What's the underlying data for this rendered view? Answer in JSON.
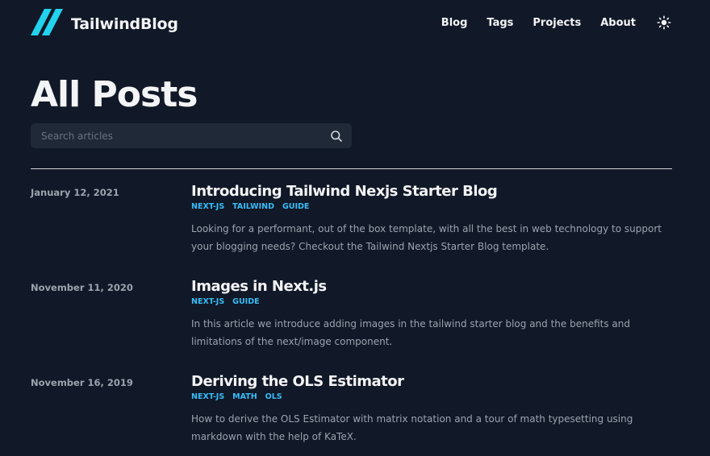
{
  "header": {
    "logo_text": "TailwindBlog",
    "nav": [
      {
        "label": "Blog"
      },
      {
        "label": "Tags"
      },
      {
        "label": "Projects"
      },
      {
        "label": "About"
      }
    ]
  },
  "page": {
    "title": "All Posts"
  },
  "search": {
    "placeholder": "Search articles"
  },
  "posts": [
    {
      "date": "January 12, 2021",
      "title": "Introducing Tailwind Nexjs Starter Blog",
      "tags": [
        "NEXT-JS",
        "TAILWIND",
        "GUIDE"
      ],
      "summary": "Looking for a performant, out of the box template, with all the best in web technology to support your blogging needs? Checkout the Tailwind Nextjs Starter Blog template."
    },
    {
      "date": "November 11, 2020",
      "title": "Images in Next.js",
      "tags": [
        "NEXT-JS",
        "GUIDE"
      ],
      "summary": "In this article we introduce adding images in the tailwind starter blog and the benefits and limitations of the next/image component."
    },
    {
      "date": "November 16, 2019",
      "title": "Deriving the OLS Estimator",
      "tags": [
        "NEXT-JS",
        "MATH",
        "OLS"
      ],
      "summary": "How to derive the OLS Estimator with matrix notation and a tour of math typesetting using markdown with the help of KaTeX."
    }
  ],
  "colors": {
    "background": "#111827",
    "accent": "#38bdf8",
    "logo_accent": "#22d3ee"
  }
}
